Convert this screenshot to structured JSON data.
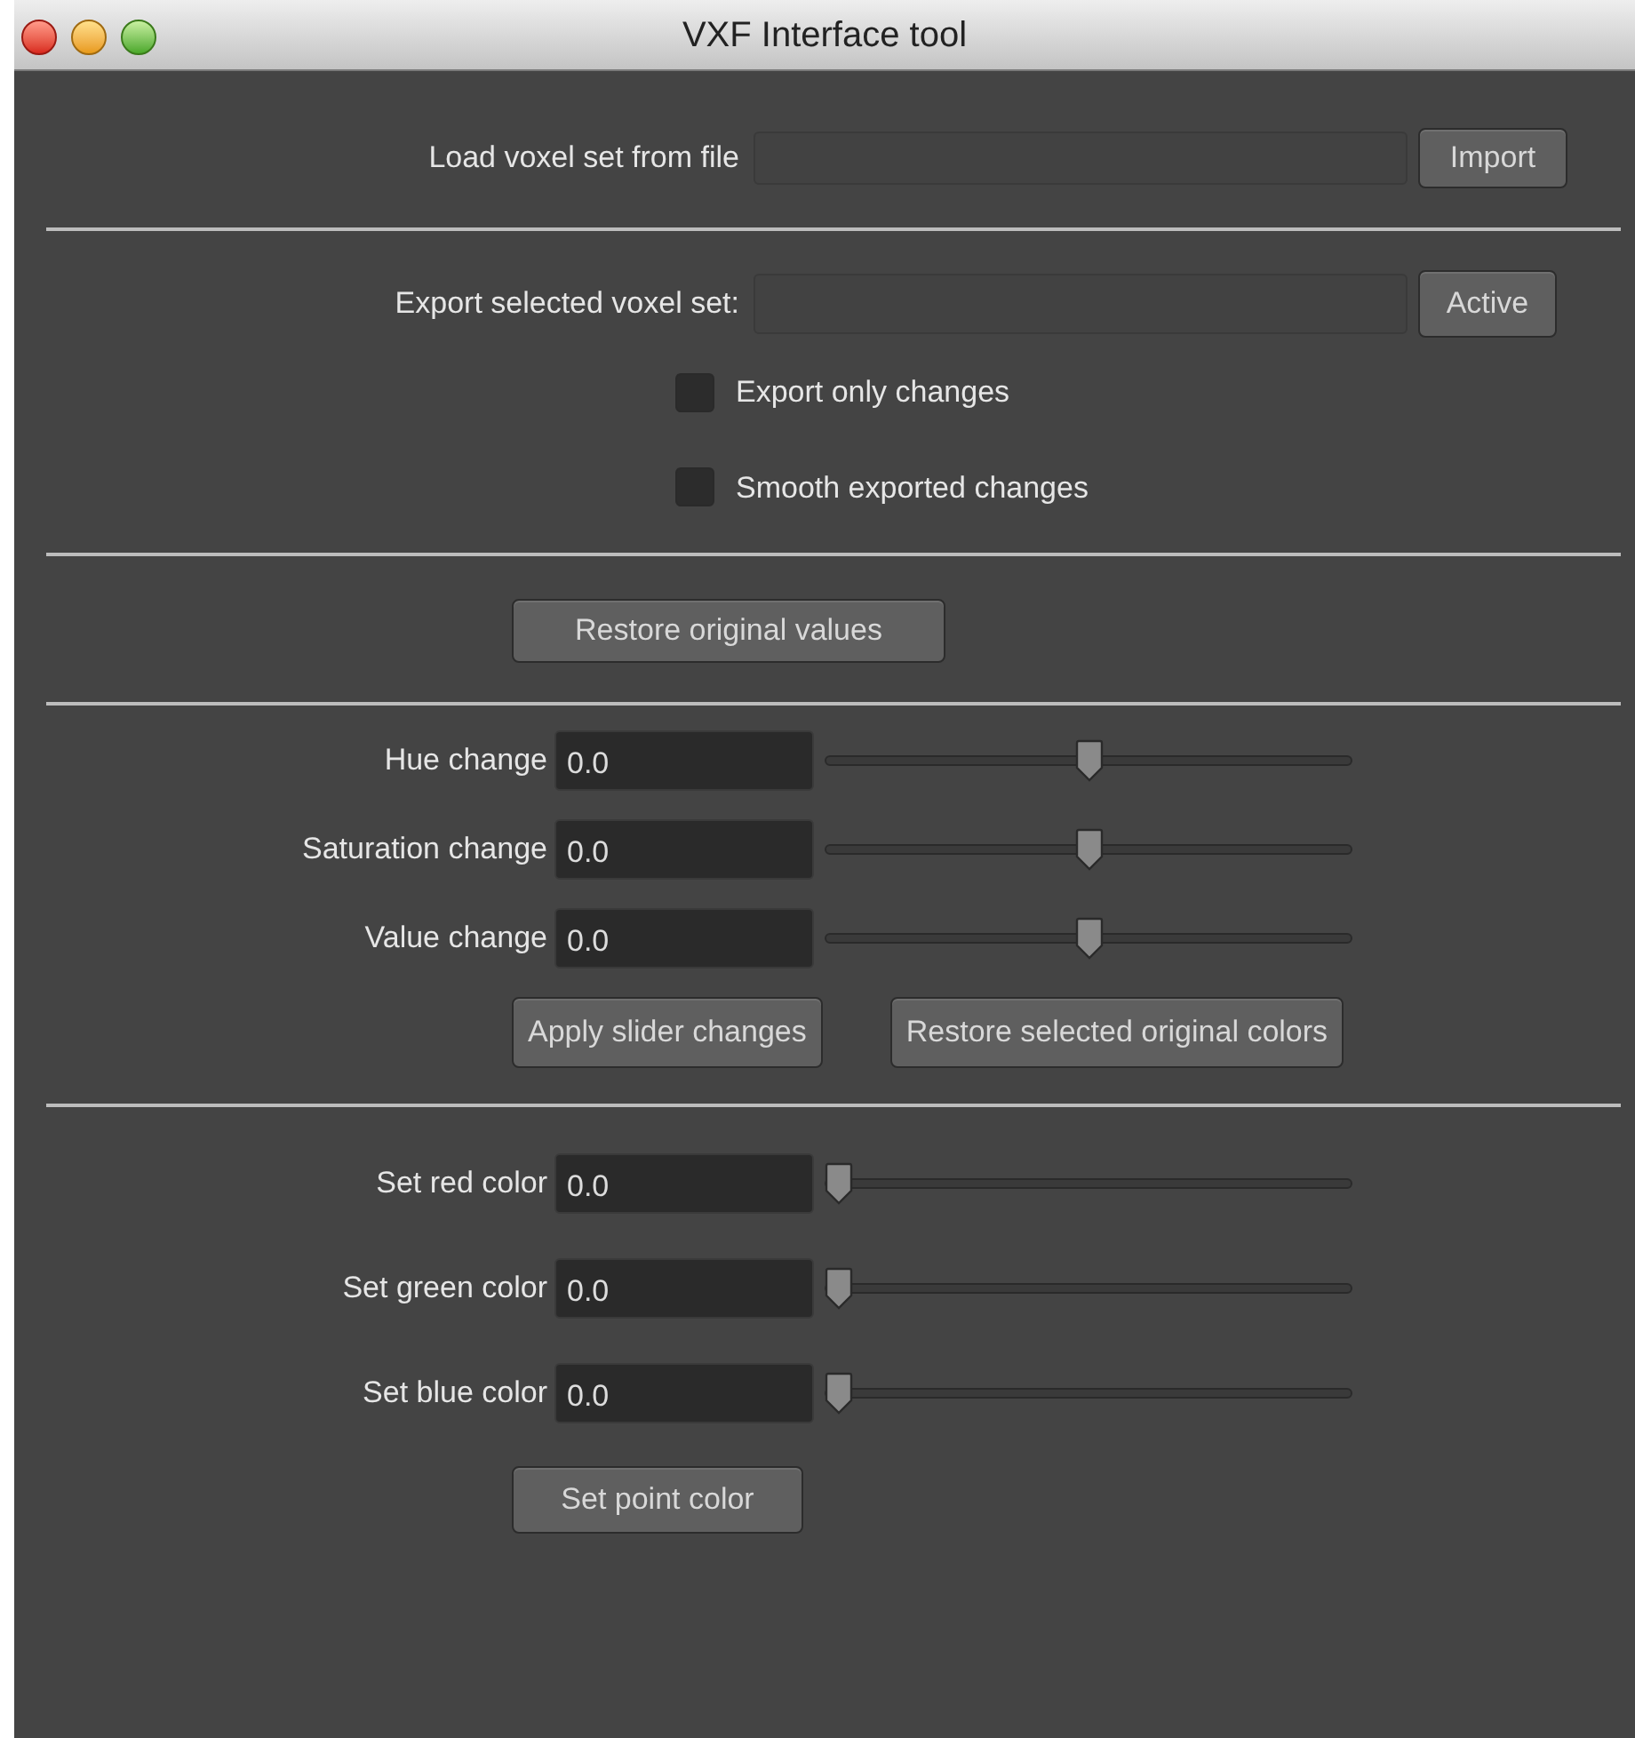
{
  "window": {
    "title": "VXF Interface tool"
  },
  "load": {
    "label": "Load voxel set from file",
    "button": "Import"
  },
  "export": {
    "label": "Export selected voxel set:",
    "button": "Active"
  },
  "options": [
    {
      "label": "Export only changes",
      "checked": false
    },
    {
      "label": "Smooth exported changes",
      "checked": false
    }
  ],
  "restore_button": "Restore original values",
  "hsv_sliders": [
    {
      "label": "Hue change",
      "value": "0.0",
      "level": 0.5
    },
    {
      "label": "Saturation change",
      "value": "0.0",
      "level": 0.5
    },
    {
      "label": "Value change",
      "value": "0.0",
      "level": 0.5
    }
  ],
  "hsv_buttons": [
    "Apply slider changes",
    "Restore selected original colors"
  ],
  "color_sliders": [
    {
      "label": "Set red color",
      "value": "0.0",
      "level": 0
    },
    {
      "label": "Set green color",
      "value": "0.0",
      "level": 0
    },
    {
      "label": "Set blue color",
      "value": "0.0",
      "level": 0
    }
  ],
  "color_button": "Set point color"
}
